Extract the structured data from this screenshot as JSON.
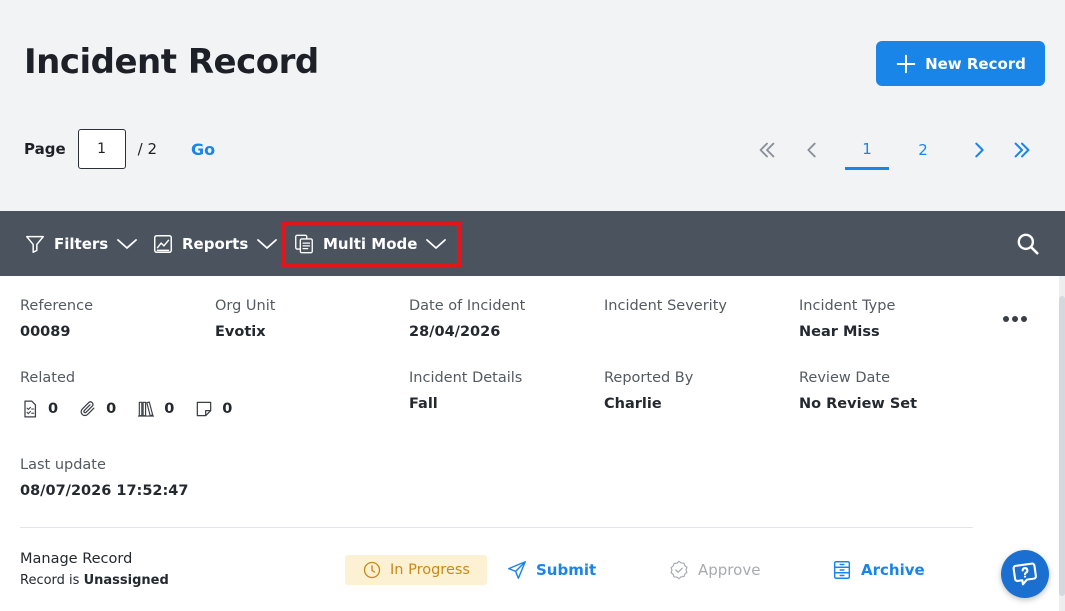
{
  "header": {
    "title": "Incident Record",
    "new_record_label": "New Record"
  },
  "pager": {
    "page_label": "Page",
    "current_page": "1",
    "total_label": "/ 2",
    "go_label": "Go",
    "pages": [
      "1",
      "2"
    ],
    "active_page": "1"
  },
  "toolbar": {
    "filters_label": "Filters",
    "reports_label": "Reports",
    "multi_mode_label": "Multi Mode",
    "highlight_color": "#e0161b"
  },
  "record": {
    "reference": {
      "label": "Reference",
      "value": "00089"
    },
    "org_unit": {
      "label": "Org Unit",
      "value": "Evotix"
    },
    "date_of_incident": {
      "label": "Date of Incident",
      "value": "28/04/2026"
    },
    "incident_severity": {
      "label": "Incident Severity",
      "value": ""
    },
    "incident_type": {
      "label": "Incident Type",
      "value": "Near Miss"
    },
    "related": {
      "label": "Related",
      "counts": [
        {
          "icon": "checklist-document-icon",
          "count": "0"
        },
        {
          "icon": "paperclip-icon",
          "count": "0"
        },
        {
          "icon": "binders-icon",
          "count": "0"
        },
        {
          "icon": "note-icon",
          "count": "0"
        }
      ]
    },
    "incident_details": {
      "label": "Incident Details",
      "value": "Fall"
    },
    "reported_by": {
      "label": "Reported By",
      "value": "Charlie"
    },
    "review_date": {
      "label": "Review Date",
      "value": "No Review Set"
    },
    "last_update": {
      "label": "Last update",
      "value": "08/07/2026 17:52:47"
    }
  },
  "manage": {
    "title": "Manage Record",
    "status_prefix": "Record is",
    "assignment": "Unassigned",
    "status_label": "In Progress",
    "submit_label": "Submit",
    "approve_label": "Approve",
    "archive_label": "Archive"
  },
  "colors": {
    "accent": "#1a85e8",
    "toolbar_bg": "#4b535f",
    "status_bg": "#fdf1d3",
    "status_text": "#c8881a"
  }
}
